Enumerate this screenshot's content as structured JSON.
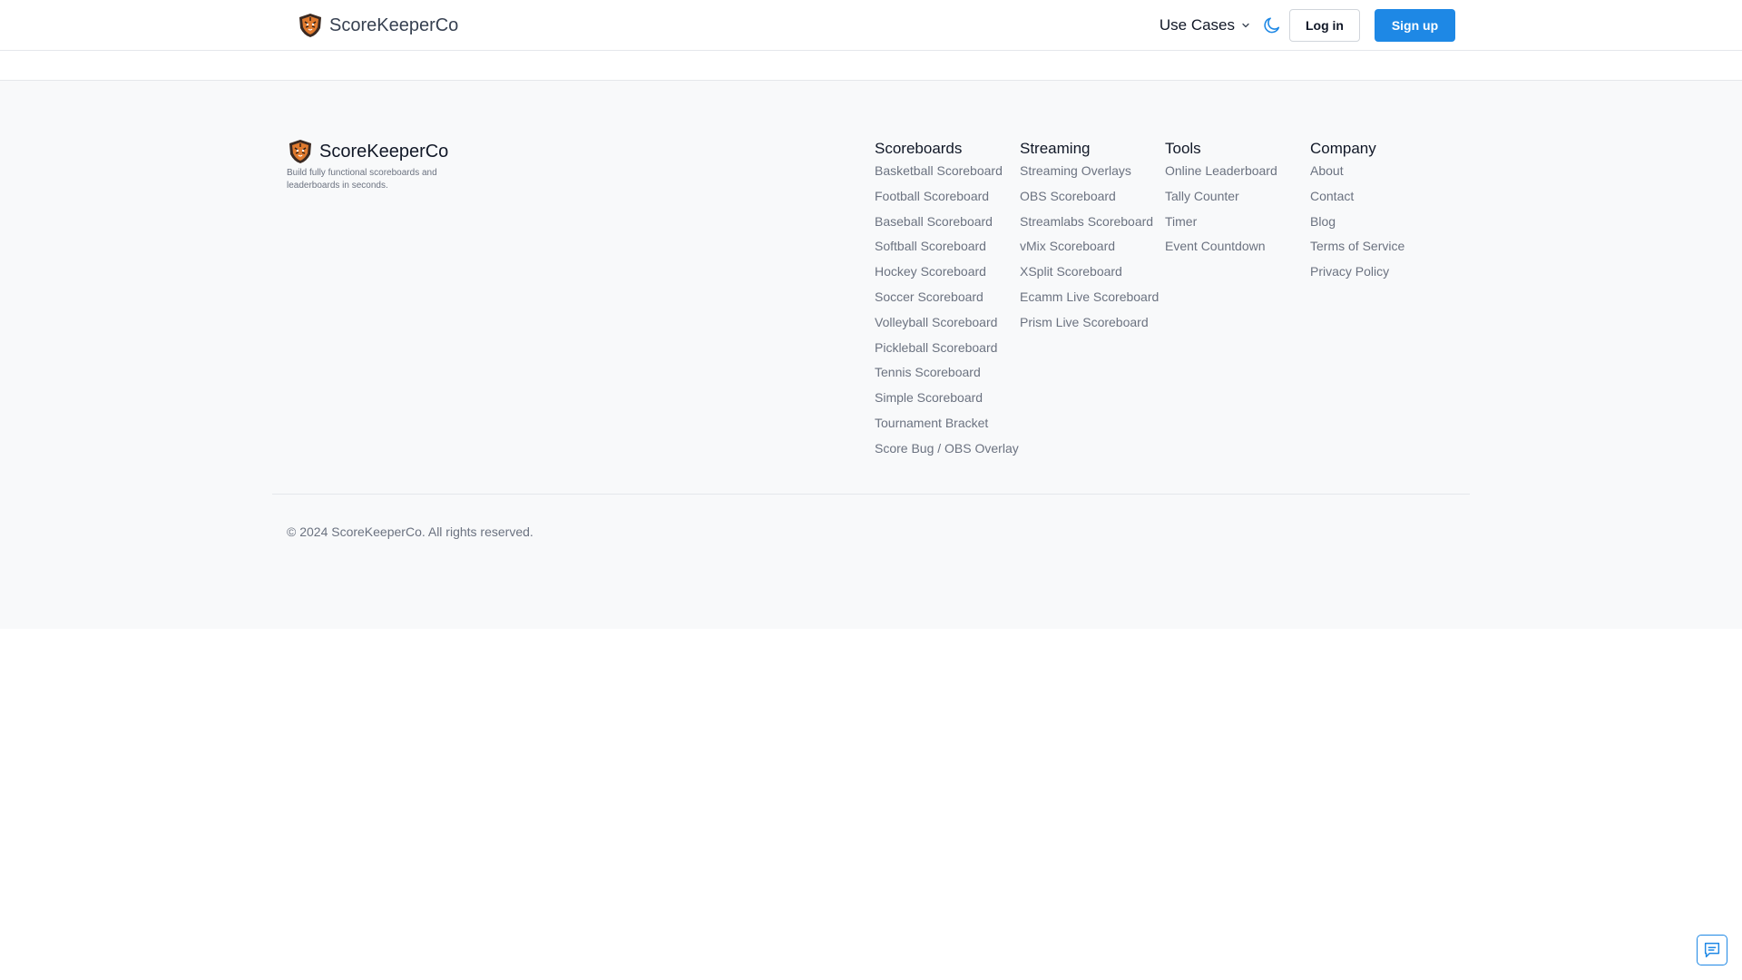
{
  "header": {
    "brand": "ScoreKeeperCo",
    "use_cases": "Use Cases",
    "login": "Log in",
    "signup": "Sign up"
  },
  "footer": {
    "brand": "ScoreKeeperCo",
    "tagline": "Build fully functional scoreboards and leaderboards in seconds.",
    "columns": [
      {
        "title": "Scoreboards",
        "links": [
          "Basketball Scoreboard",
          "Football Scoreboard",
          "Baseball Scoreboard",
          "Softball Scoreboard",
          "Hockey Scoreboard",
          "Soccer Scoreboard",
          "Volleyball Scoreboard",
          "Pickleball Scoreboard",
          "Tennis Scoreboard",
          "Simple Scoreboard",
          "Tournament Bracket",
          "Score Bug / OBS Overlay"
        ]
      },
      {
        "title": "Streaming",
        "links": [
          "Streaming Overlays",
          "OBS Scoreboard",
          "Streamlabs Scoreboard",
          "vMix Scoreboard",
          "XSplit Scoreboard",
          "Ecamm Live Scoreboard",
          "Prism Live Scoreboard"
        ]
      },
      {
        "title": "Tools",
        "links": [
          "Online Leaderboard",
          "Tally Counter",
          "Timer",
          "Event Countdown"
        ]
      },
      {
        "title": "Company",
        "links": [
          "About",
          "Contact",
          "Blog",
          "Terms of Service",
          "Privacy Policy"
        ]
      }
    ],
    "copyright": "© 2024 ScoreKeeperCo. All rights reserved."
  },
  "colors": {
    "accent": "#1e88e5",
    "footer_bg": "#f8f9fa",
    "link_text": "#6b7280"
  },
  "icons": {
    "logo": "tiger-shield-logo",
    "dropdown": "chevron-down-icon",
    "theme": "moon-icon",
    "chat": "chat-icon"
  }
}
